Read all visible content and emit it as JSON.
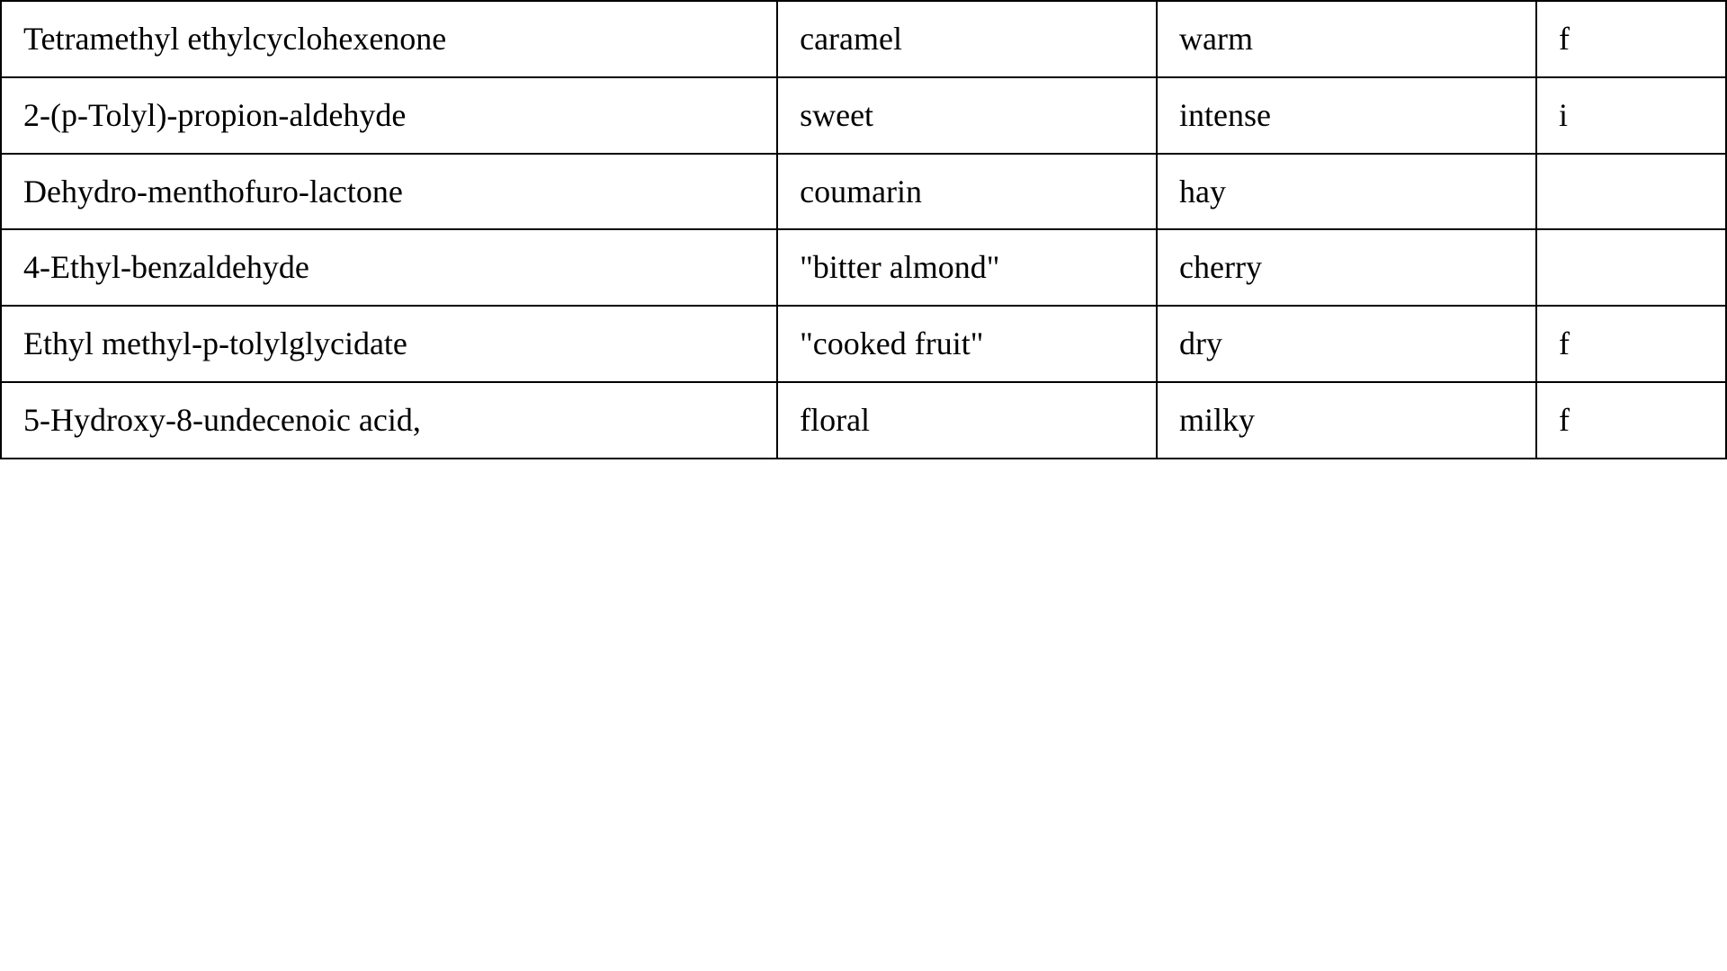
{
  "table": {
    "rows": [
      {
        "compound": "Tetramethyl ethylcyclohexenone",
        "odor1": "caramel",
        "odor2": "warm",
        "odor3": "f"
      },
      {
        "compound": "2-(p-Tolyl)-propion-aldehyde",
        "odor1": "sweet",
        "odor2": "intense",
        "odor3": "i"
      },
      {
        "compound": "Dehydro-menthofuro-lactone",
        "odor1": "coumarin",
        "odor2": "hay",
        "odor3": ""
      },
      {
        "compound": "4-Ethyl-benzaldehyde",
        "odor1": "\"bitter almond\"",
        "odor2": "cherry",
        "odor3": ""
      },
      {
        "compound": "Ethyl methyl-p-tolylglycidate",
        "odor1": "\"cooked fruit\"",
        "odor2": "dry",
        "odor3": "f"
      },
      {
        "compound": "5-Hydroxy-8-undecenoic acid,",
        "odor1": "floral",
        "odor2": "milky",
        "odor3": "f"
      }
    ]
  }
}
